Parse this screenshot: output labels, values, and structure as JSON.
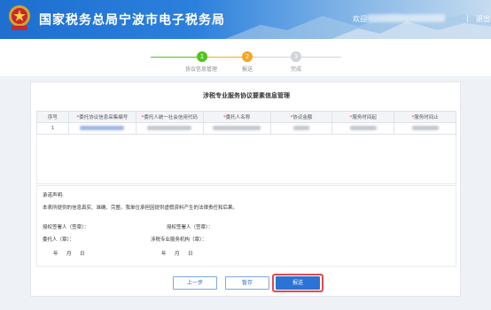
{
  "header": {
    "title": "国家税务总局宁波市电子税务局",
    "welcome": "欢迎",
    "separator": "|",
    "exit": "退出"
  },
  "steps": [
    {
      "num": "1",
      "label": "协议信息管理",
      "state": "done"
    },
    {
      "num": "2",
      "label": "报送",
      "state": "current"
    },
    {
      "num": "3",
      "label": "完成",
      "state": "pending"
    }
  ],
  "card": {
    "title": "涉税专业服务协议要素信息管理",
    "columns": [
      {
        "label": "序号",
        "required": false
      },
      {
        "label": "委托协议信息采集编号",
        "required": true
      },
      {
        "label": "委托人统一社会信用代码",
        "required": true
      },
      {
        "label": "委托人名称",
        "required": true
      },
      {
        "label": "协议金额",
        "required": true
      },
      {
        "label": "服务时间起",
        "required": true
      },
      {
        "label": "服务时间止",
        "required": true
      }
    ],
    "rows": [
      {
        "index": "1"
      }
    ]
  },
  "pledge": {
    "heading": "承诺声明:",
    "statement": "本表所提供的信息真实、准确、完整。我单位承担因提供虚假资料产生的法律责任和后果。",
    "left_signer": "授权签署人（签章）：",
    "right_signer": "授权签署人（签章）：",
    "principal": "委托人（章）：",
    "agency": "涉税专业服务机构（章）：",
    "year": "年",
    "month": "月",
    "day": "日"
  },
  "buttons": {
    "prev": "上一步",
    "save": "暂存",
    "submit": "报送"
  },
  "colors": {
    "header_blue": "#1e6fd0",
    "step_done": "#52c41a",
    "step_current": "#f5a623",
    "step_pending": "#cfd4da",
    "primary": "#2b73d4",
    "highlight": "#e14b4b"
  }
}
